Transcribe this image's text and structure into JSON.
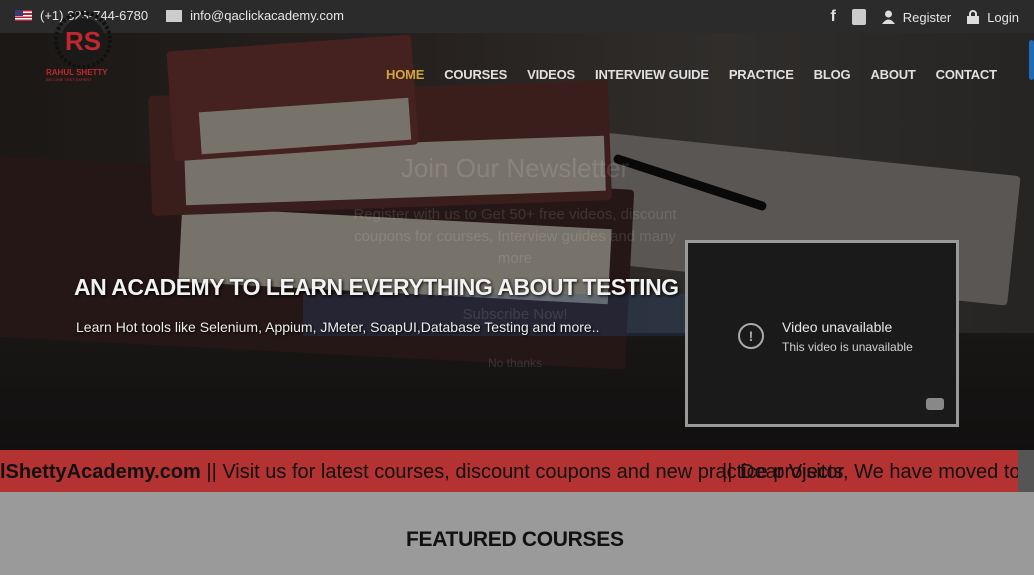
{
  "topbar": {
    "phone": "(+1) 323-744-6780",
    "email": "info@qaclickacademy.com",
    "register": "Register",
    "login": "Login"
  },
  "logo": {
    "line1": "RAHUL SHETTY",
    "line2": "BECOME TEST EXPERT"
  },
  "nav": {
    "items": [
      {
        "label": "HOME",
        "active": true
      },
      {
        "label": "COURSES"
      },
      {
        "label": "VIDEOS"
      },
      {
        "label": "INTERVIEW GUIDE"
      },
      {
        "label": "PRACTICE"
      },
      {
        "label": "BLOG"
      },
      {
        "label": "ABOUT"
      },
      {
        "label": "CONTACT"
      }
    ]
  },
  "hero": {
    "title": "AN ACADEMY TO LEARN EVERYTHING ABOUT TESTING",
    "subtitle": "Learn Hot tools like Selenium, Appium, JMeter, SoapUI,Database Testing and more.."
  },
  "newsletter": {
    "title": "Join Our Newsletter",
    "text": "Register with us to Get 50+ free videos, discount coupons for courses, Interview guides and many more",
    "button": "Subscribe Now!",
    "dismiss": "No thanks"
  },
  "video": {
    "title": "Video unavailable",
    "subtitle": "This video is unavailable"
  },
  "ticker": {
    "bold": "lShettyAcademy.com",
    "text": " || Visit us for latest courses, discount coupons and new practice projects",
    "overlay": "||",
    "overlay2": "Dear Visitor, We have moved to"
  },
  "featured": {
    "title": "FEATURED COURSES"
  },
  "colors": {
    "accent": "#d4a53f",
    "ticker": "#b43232",
    "topbar": "#2b2b2b"
  }
}
